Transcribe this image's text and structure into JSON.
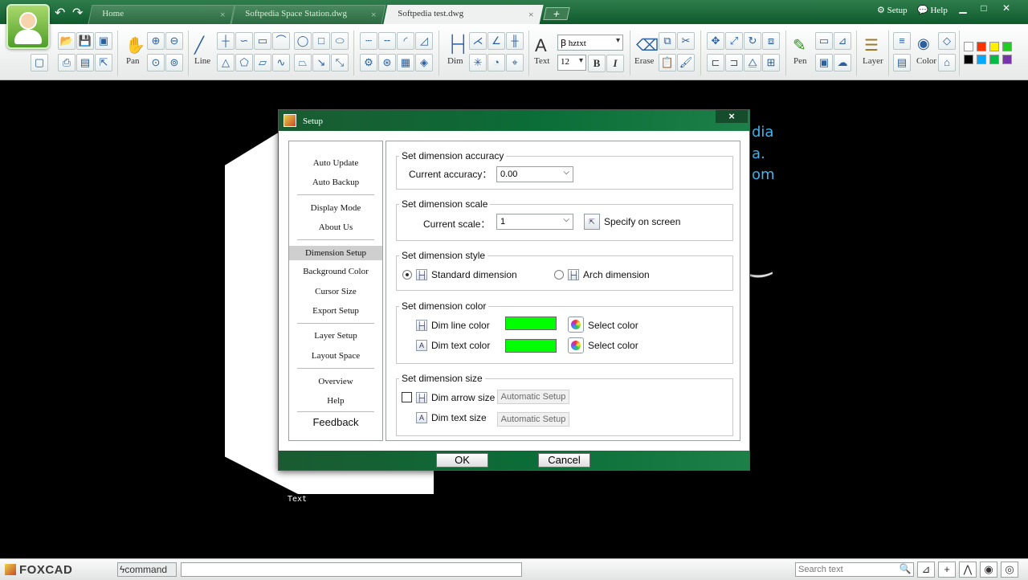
{
  "app": {
    "tabs": [
      {
        "label": "Home",
        "active": false
      },
      {
        "label": "Softpedia Space Station.dwg",
        "active": false
      },
      {
        "label": "Softpedia test.dwg",
        "active": true
      }
    ],
    "tab_close": "×",
    "tab_add": "+",
    "setup_label": "Setup",
    "help_label": "Help"
  },
  "toolbar": {
    "pan_label": "Pan",
    "line_label": "Line",
    "dim_label": "Dim",
    "text_label": "Text",
    "font_name": "hztxt",
    "font_size": "12",
    "bold": "B",
    "italic": "I",
    "erase_label": "Erase",
    "pen_label": "Pen",
    "layer_label": "Layer",
    "color_label": "Color",
    "palette": [
      "#ffffff",
      "#ff3300",
      "#ffee00",
      "#22cc22",
      "#000000",
      "#00aaff",
      "#00bb44",
      "#7733aa"
    ]
  },
  "canvas": {
    "text_label": "Text",
    "blue_text": [
      "dia",
      "a.",
      "om"
    ]
  },
  "dialog": {
    "title": "Setup",
    "close": "×",
    "nav": {
      "items": [
        "Auto Update",
        "Auto Backup",
        "Display Mode",
        "About Us",
        "Dimension Setup",
        "Background Color",
        "Cursor Size",
        "Export Setup",
        "Layer Setup",
        "Layout Space",
        "Overview",
        "Help",
        "Feedback"
      ],
      "selected": "Dimension Setup"
    },
    "accuracy": {
      "group": "Set dimension accuracy",
      "label": "Current accuracy：",
      "value": "0.00"
    },
    "scale": {
      "group": "Set dimension scale",
      "label": "Current scale：",
      "value": "1",
      "specify": "Specify on screen"
    },
    "style": {
      "group": "Set dimension style",
      "standard": "Standard dimension",
      "arch": "Arch dimension",
      "selected": "standard"
    },
    "color": {
      "group": "Set dimension color",
      "line_label": "Dim line color",
      "text_label": "Dim text color",
      "line_color": "#00ff00",
      "text_color": "#00ff00",
      "select_line": "Select color",
      "select_text": "Select color"
    },
    "size": {
      "group": "Set dimension size",
      "arrow_label": "Dim arrow size",
      "text_label": "Dim text size",
      "arrow_auto": "Automatic Setup",
      "text_auto": "Automatic Setup"
    },
    "ok": "OK",
    "cancel": "Cancel"
  },
  "statusbar": {
    "logo": "FOXCAD",
    "command_label": "command",
    "search_placeholder": "Search text"
  },
  "icons": {
    "pen": "✎",
    "magnifier": "🔍"
  }
}
